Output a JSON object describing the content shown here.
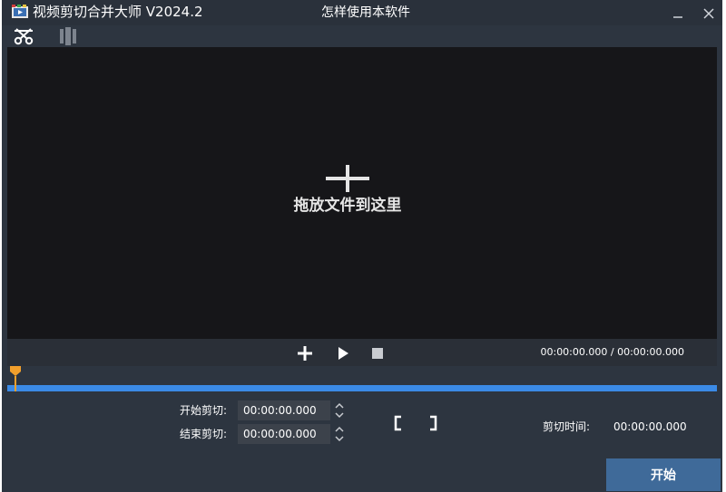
{
  "app": {
    "title": "视频剪切合并大师 V2024.2",
    "help_link": "怎样使用本软件"
  },
  "toolbar": {
    "items": [
      {
        "name": "cut-tool",
        "icon": "scissors-icon"
      },
      {
        "name": "merge-tool",
        "icon": "film-strip-icon"
      }
    ]
  },
  "preview": {
    "drop_text": "拖放文件到这里",
    "drop_icon": "plus-icon"
  },
  "player": {
    "current_time": "00:00:00.000",
    "separator": " / ",
    "total_time": "00:00:00.000",
    "position_fraction": 0.0
  },
  "trim": {
    "start_label": "开始剪切:",
    "start_value": "00:00:00.000",
    "end_label": "结束剪切:",
    "end_value": "00:00:00.000",
    "cut_time_label": "剪切时间:",
    "cut_time_value": "00:00:00.000"
  },
  "actions": {
    "start_label": "开始"
  },
  "colors": {
    "window_bg": "#2d3540",
    "preview_bg": "#161619",
    "track": "#3b8ae6",
    "playhead": "#f2a02c",
    "primary_button": "#3f6a99"
  }
}
